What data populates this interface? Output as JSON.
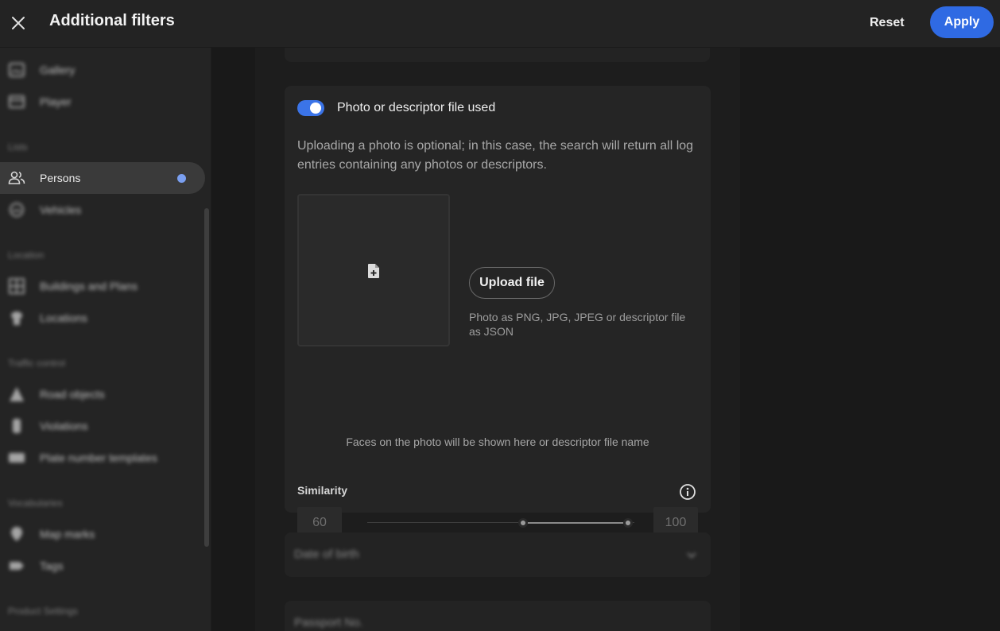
{
  "header": {
    "title": "Additional filters",
    "reset_label": "Reset",
    "apply_label": "Apply"
  },
  "sidebar": {
    "items": [
      {
        "label": "Gallery",
        "icon": "image-icon"
      },
      {
        "label": "Player",
        "icon": "player-icon"
      },
      {
        "label": "Persons",
        "icon": "persons-icon",
        "active": true
      },
      {
        "label": "Vehicles",
        "icon": "vehicle-icon"
      },
      {
        "label": "Buildings and Plans",
        "icon": "building-icon"
      },
      {
        "label": "Locations",
        "icon": "location-icon"
      },
      {
        "label": "Road objects",
        "icon": "road-object-icon"
      },
      {
        "label": "Violations",
        "icon": "violation-icon"
      },
      {
        "label": "Plate number templates",
        "icon": "plate-icon"
      },
      {
        "label": "Map marks",
        "icon": "map-mark-icon"
      },
      {
        "label": "Tags",
        "icon": "tag-icon"
      }
    ],
    "sections": [
      "Lists",
      "Location",
      "Traffic control",
      "Vocabularies",
      "Product Settings"
    ]
  },
  "photo_filter": {
    "toggle_label": "Photo or descriptor file used",
    "toggle_on": true,
    "description": "Uploading a photo is optional; in this case, the search will return all log entries containing any photos or descriptors.",
    "upload_label": "Upload file",
    "upload_hint": "Photo as PNG, JPG, JPEG or descriptor file as JSON",
    "faces_note": "Faces on the photo will be shown here or descriptor file name"
  },
  "similarity": {
    "label": "Similarity",
    "min": "60",
    "max": "100"
  },
  "collapsed_filters": {
    "date_of_birth": "Date of birth",
    "passport": "Passport No."
  },
  "colors": {
    "accent": "#2f6ae3",
    "indicator": "#7a9ff0"
  }
}
